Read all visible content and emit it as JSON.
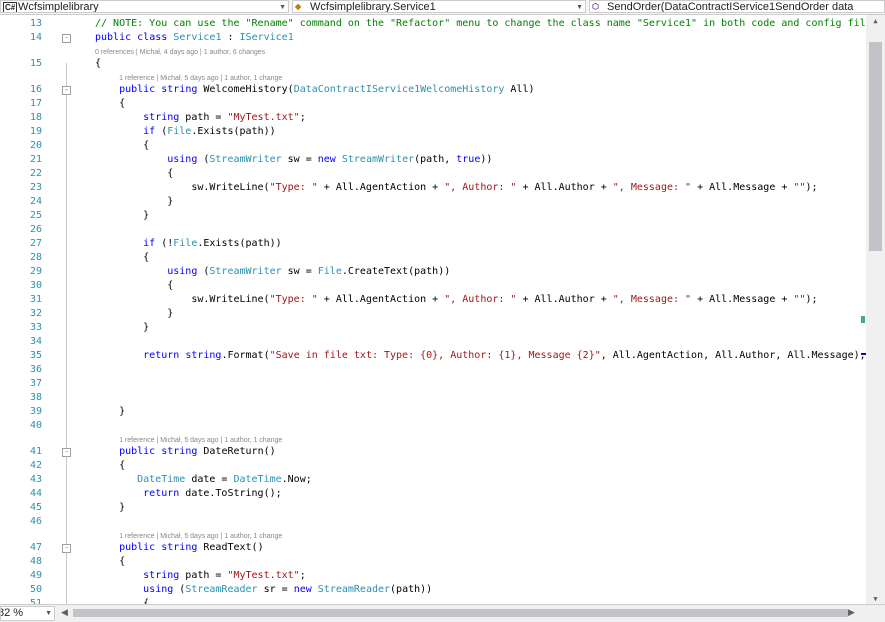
{
  "navbar": {
    "project": {
      "icon": "csharp-project-icon",
      "icon_text": "C#",
      "label": "Wcfsimplelibrary"
    },
    "class_combo": {
      "icon": "class-icon",
      "label": "Wcfsimplelibrary.Service1"
    },
    "member_combo": {
      "icon": "method-icon",
      "label": "SendOrder(DataContractIService1SendOrder data"
    }
  },
  "colors": {
    "keyword": "#0000ff",
    "type": "#2b91af",
    "string": "#a31515",
    "comment": "#008000",
    "line_number": "#2b91af",
    "codelens": "#888888"
  },
  "code_lines": [
    {
      "num": "13",
      "fold": "",
      "lens": "",
      "lens_indent": 0,
      "indent": 0,
      "tokens": [
        {
          "c": "c",
          "t": "// NOTE: You can use the \"Rename\" command on the \"Refactor\" menu to change the class name \"Service1\" in both code and config file t"
        }
      ]
    },
    {
      "num": "14",
      "fold": "-",
      "lens": "",
      "lens_indent": 0,
      "indent": 0,
      "tokens": [
        {
          "c": "k",
          "t": "public"
        },
        {
          "c": "",
          "t": " "
        },
        {
          "c": "k",
          "t": "class"
        },
        {
          "c": "",
          "t": " "
        },
        {
          "c": "t",
          "t": "Service1"
        },
        {
          "c": "",
          "t": " : "
        },
        {
          "c": "t",
          "t": "IService1"
        }
      ]
    },
    {
      "num": "15",
      "fold": "",
      "lens": "0 references | Michał, 4 days ago | 1 author, 6 changes",
      "lens_indent": 0,
      "indent": 0,
      "tokens": [
        {
          "c": "",
          "t": "{"
        }
      ]
    },
    {
      "num": "16",
      "fold": "-",
      "lens": "1 reference | Michał, 5 days ago | 1 author, 1 change",
      "lens_indent": 4,
      "indent": 4,
      "tokens": [
        {
          "c": "k",
          "t": "public"
        },
        {
          "c": "",
          "t": " "
        },
        {
          "c": "k",
          "t": "string"
        },
        {
          "c": "",
          "t": " WelcomeHistory("
        },
        {
          "c": "t",
          "t": "DataContractIService1WelcomeHistory"
        },
        {
          "c": "",
          "t": " All)"
        }
      ]
    },
    {
      "num": "17",
      "fold": "",
      "lens": "",
      "lens_indent": 0,
      "indent": 4,
      "tokens": [
        {
          "c": "",
          "t": "{"
        }
      ]
    },
    {
      "num": "18",
      "fold": "",
      "lens": "",
      "lens_indent": 0,
      "indent": 8,
      "tokens": [
        {
          "c": "k",
          "t": "string"
        },
        {
          "c": "",
          "t": " path = "
        },
        {
          "c": "s",
          "t": "\"MyTest.txt\""
        },
        {
          "c": "",
          "t": ";"
        }
      ]
    },
    {
      "num": "19",
      "fold": "",
      "lens": "",
      "lens_indent": 0,
      "indent": 8,
      "tokens": [
        {
          "c": "k",
          "t": "if"
        },
        {
          "c": "",
          "t": " ("
        },
        {
          "c": "t",
          "t": "File"
        },
        {
          "c": "",
          "t": ".Exists(path))"
        }
      ]
    },
    {
      "num": "20",
      "fold": "",
      "lens": "",
      "lens_indent": 0,
      "indent": 8,
      "tokens": [
        {
          "c": "",
          "t": "{"
        }
      ]
    },
    {
      "num": "21",
      "fold": "",
      "lens": "",
      "lens_indent": 0,
      "indent": 12,
      "tokens": [
        {
          "c": "k",
          "t": "using"
        },
        {
          "c": "",
          "t": " ("
        },
        {
          "c": "t",
          "t": "StreamWriter"
        },
        {
          "c": "",
          "t": " sw = "
        },
        {
          "c": "k",
          "t": "new"
        },
        {
          "c": "",
          "t": " "
        },
        {
          "c": "t",
          "t": "StreamWriter"
        },
        {
          "c": "",
          "t": "(path, "
        },
        {
          "c": "k",
          "t": "true"
        },
        {
          "c": "",
          "t": "))"
        }
      ]
    },
    {
      "num": "22",
      "fold": "",
      "lens": "",
      "lens_indent": 0,
      "indent": 12,
      "tokens": [
        {
          "c": "",
          "t": "{"
        }
      ]
    },
    {
      "num": "23",
      "fold": "",
      "lens": "",
      "lens_indent": 0,
      "indent": 16,
      "tokens": [
        {
          "c": "",
          "t": "sw.WriteLine("
        },
        {
          "c": "s",
          "t": "\"Type: \""
        },
        {
          "c": "",
          "t": " + All.AgentAction + "
        },
        {
          "c": "s",
          "t": "\", Author: \""
        },
        {
          "c": "",
          "t": " + All.Author + "
        },
        {
          "c": "s",
          "t": "\", Message: \""
        },
        {
          "c": "",
          "t": " + All.Message + "
        },
        {
          "c": "s",
          "t": "\"\""
        },
        {
          "c": "",
          "t": ");"
        }
      ]
    },
    {
      "num": "24",
      "fold": "",
      "lens": "",
      "lens_indent": 0,
      "indent": 12,
      "tokens": [
        {
          "c": "",
          "t": "}"
        }
      ]
    },
    {
      "num": "25",
      "fold": "",
      "lens": "",
      "lens_indent": 0,
      "indent": 8,
      "tokens": [
        {
          "c": "",
          "t": "}"
        }
      ]
    },
    {
      "num": "26",
      "fold": "",
      "lens": "",
      "lens_indent": 0,
      "indent": 0,
      "tokens": []
    },
    {
      "num": "27",
      "fold": "",
      "lens": "",
      "lens_indent": 0,
      "indent": 8,
      "tokens": [
        {
          "c": "k",
          "t": "if"
        },
        {
          "c": "",
          "t": " (!"
        },
        {
          "c": "t",
          "t": "File"
        },
        {
          "c": "",
          "t": ".Exists(path))"
        }
      ]
    },
    {
      "num": "28",
      "fold": "",
      "lens": "",
      "lens_indent": 0,
      "indent": 8,
      "tokens": [
        {
          "c": "",
          "t": "{"
        }
      ]
    },
    {
      "num": "29",
      "fold": "",
      "lens": "",
      "lens_indent": 0,
      "indent": 12,
      "tokens": [
        {
          "c": "k",
          "t": "using"
        },
        {
          "c": "",
          "t": " ("
        },
        {
          "c": "t",
          "t": "StreamWriter"
        },
        {
          "c": "",
          "t": " sw = "
        },
        {
          "c": "t",
          "t": "File"
        },
        {
          "c": "",
          "t": ".CreateText(path))"
        }
      ]
    },
    {
      "num": "30",
      "fold": "",
      "lens": "",
      "lens_indent": 0,
      "indent": 12,
      "tokens": [
        {
          "c": "",
          "t": "{"
        }
      ]
    },
    {
      "num": "31",
      "fold": "",
      "lens": "",
      "lens_indent": 0,
      "indent": 16,
      "tokens": [
        {
          "c": "",
          "t": "sw.WriteLine("
        },
        {
          "c": "s",
          "t": "\"Type: \""
        },
        {
          "c": "",
          "t": " + All.AgentAction + "
        },
        {
          "c": "s",
          "t": "\", Author: \""
        },
        {
          "c": "",
          "t": " + All.Author + "
        },
        {
          "c": "s",
          "t": "\", Message: \""
        },
        {
          "c": "",
          "t": " + All.Message + "
        },
        {
          "c": "s",
          "t": "\"\""
        },
        {
          "c": "",
          "t": ");"
        }
      ]
    },
    {
      "num": "32",
      "fold": "",
      "lens": "",
      "lens_indent": 0,
      "indent": 12,
      "tokens": [
        {
          "c": "",
          "t": "}"
        }
      ]
    },
    {
      "num": "33",
      "fold": "",
      "lens": "",
      "lens_indent": 0,
      "indent": 8,
      "tokens": [
        {
          "c": "",
          "t": "}"
        }
      ]
    },
    {
      "num": "34",
      "fold": "",
      "lens": "",
      "lens_indent": 0,
      "indent": 0,
      "tokens": []
    },
    {
      "num": "35",
      "fold": "",
      "lens": "",
      "lens_indent": 0,
      "indent": 8,
      "tokens": [
        {
          "c": "k",
          "t": "return"
        },
        {
          "c": "",
          "t": " "
        },
        {
          "c": "k",
          "t": "string"
        },
        {
          "c": "",
          "t": ".Format("
        },
        {
          "c": "s",
          "t": "\"Save in file txt: Type: {0}, Author: {1}, Message {2}\""
        },
        {
          "c": "",
          "t": ", All.AgentAction, All.Author, All.Message);"
        }
      ]
    },
    {
      "num": "36",
      "fold": "",
      "lens": "",
      "lens_indent": 0,
      "indent": 0,
      "tokens": []
    },
    {
      "num": "37",
      "fold": "",
      "lens": "",
      "lens_indent": 0,
      "indent": 0,
      "tokens": []
    },
    {
      "num": "38",
      "fold": "",
      "lens": "",
      "lens_indent": 0,
      "indent": 0,
      "tokens": []
    },
    {
      "num": "39",
      "fold": "",
      "lens": "",
      "lens_indent": 0,
      "indent": 4,
      "tokens": [
        {
          "c": "",
          "t": "}"
        }
      ]
    },
    {
      "num": "40",
      "fold": "",
      "lens": "",
      "lens_indent": 0,
      "indent": 0,
      "tokens": []
    },
    {
      "num": "41",
      "fold": "-",
      "lens": "1 reference | Michał, 5 days ago | 1 author, 1 change",
      "lens_indent": 4,
      "indent": 4,
      "tokens": [
        {
          "c": "k",
          "t": "public"
        },
        {
          "c": "",
          "t": " "
        },
        {
          "c": "k",
          "t": "string"
        },
        {
          "c": "",
          "t": " DateReturn()"
        }
      ]
    },
    {
      "num": "42",
      "fold": "",
      "lens": "",
      "lens_indent": 0,
      "indent": 4,
      "tokens": [
        {
          "c": "",
          "t": "{"
        }
      ]
    },
    {
      "num": "43",
      "fold": "",
      "lens": "",
      "lens_indent": 0,
      "indent": 7,
      "tokens": [
        {
          "c": "t",
          "t": "DateTime"
        },
        {
          "c": "",
          "t": " date = "
        },
        {
          "c": "t",
          "t": "DateTime"
        },
        {
          "c": "",
          "t": ".Now;"
        }
      ]
    },
    {
      "num": "44",
      "fold": "",
      "lens": "",
      "lens_indent": 0,
      "indent": 8,
      "tokens": [
        {
          "c": "k",
          "t": "return"
        },
        {
          "c": "",
          "t": " date.ToString();"
        }
      ]
    },
    {
      "num": "45",
      "fold": "",
      "lens": "",
      "lens_indent": 0,
      "indent": 4,
      "tokens": [
        {
          "c": "",
          "t": "}"
        }
      ]
    },
    {
      "num": "46",
      "fold": "",
      "lens": "",
      "lens_indent": 0,
      "indent": 0,
      "tokens": []
    },
    {
      "num": "47",
      "fold": "-",
      "lens": "1 reference | Michał, 5 days ago | 1 author, 1 change",
      "lens_indent": 4,
      "indent": 4,
      "tokens": [
        {
          "c": "k",
          "t": "public"
        },
        {
          "c": "",
          "t": " "
        },
        {
          "c": "k",
          "t": "string"
        },
        {
          "c": "",
          "t": " ReadText()"
        }
      ]
    },
    {
      "num": "48",
      "fold": "",
      "lens": "",
      "lens_indent": 0,
      "indent": 4,
      "tokens": [
        {
          "c": "",
          "t": "{"
        }
      ]
    },
    {
      "num": "49",
      "fold": "",
      "lens": "",
      "lens_indent": 0,
      "indent": 8,
      "tokens": [
        {
          "c": "k",
          "t": "string"
        },
        {
          "c": "",
          "t": " path = "
        },
        {
          "c": "s",
          "t": "\"MyTest.txt\""
        },
        {
          "c": "",
          "t": ";"
        }
      ]
    },
    {
      "num": "50",
      "fold": "",
      "lens": "",
      "lens_indent": 0,
      "indent": 8,
      "tokens": [
        {
          "c": "k",
          "t": "using"
        },
        {
          "c": "",
          "t": " ("
        },
        {
          "c": "t",
          "t": "StreamReader"
        },
        {
          "c": "",
          "t": " sr = "
        },
        {
          "c": "k",
          "t": "new"
        },
        {
          "c": "",
          "t": " "
        },
        {
          "c": "t",
          "t": "StreamReader"
        },
        {
          "c": "",
          "t": "(path))"
        }
      ]
    },
    {
      "num": "51",
      "fold": "",
      "lens": "",
      "lens_indent": 0,
      "indent": 8,
      "tokens": [
        {
          "c": "",
          "t": "{"
        }
      ]
    }
  ],
  "statusbar": {
    "zoom": "82 %",
    "zoom_arrow_icon": "chevron-down-icon"
  },
  "scroll_icons": {
    "up": "scroll-up-arrow-icon",
    "down": "scroll-down-arrow-icon",
    "left": "scroll-left-arrow-icon",
    "right": "scroll-right-arrow-icon"
  }
}
